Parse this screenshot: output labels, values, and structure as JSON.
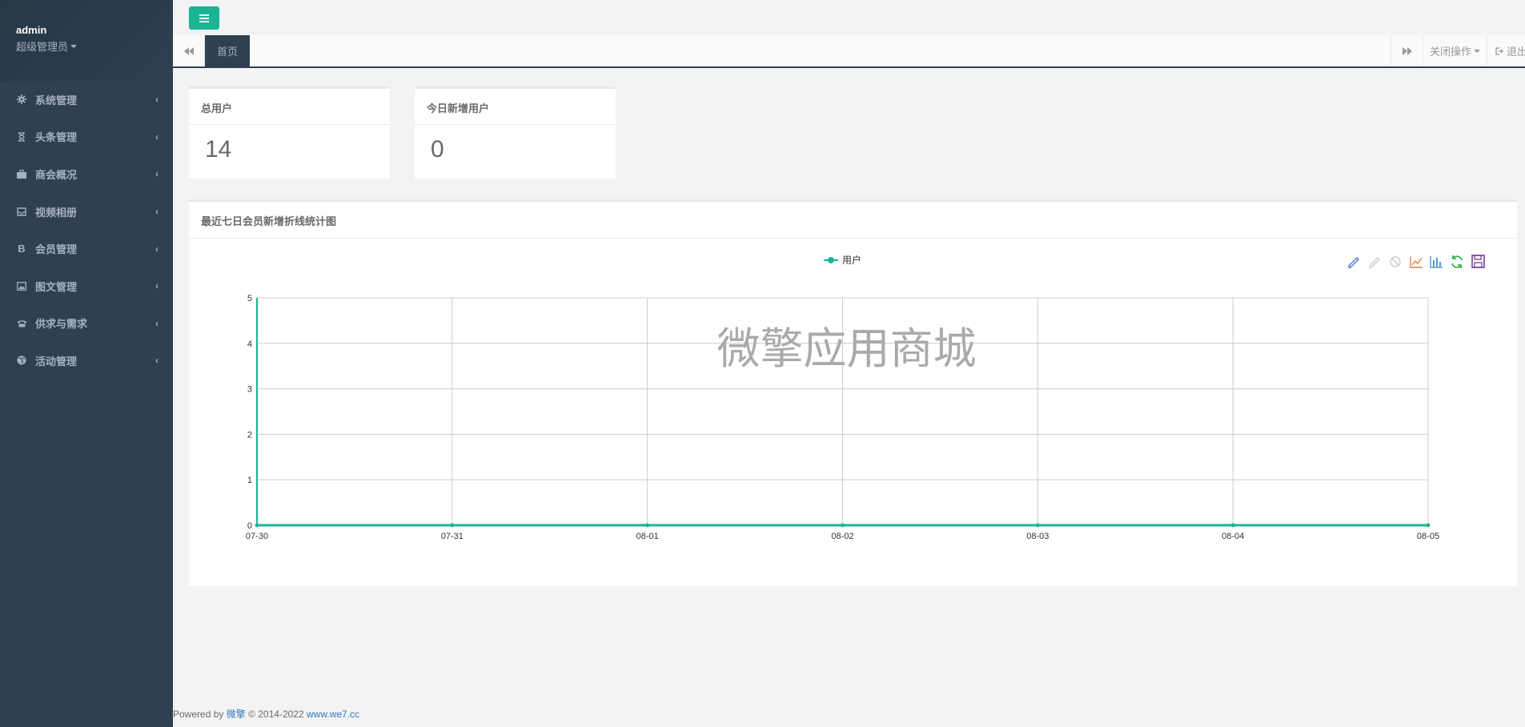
{
  "sidebar": {
    "username": "admin",
    "role": "超级管理员",
    "items": [
      {
        "label": "系统管理",
        "icon": "gear-icon"
      },
      {
        "label": "头条管理",
        "icon": "hourglass-icon"
      },
      {
        "label": "商会概况",
        "icon": "briefcase-icon"
      },
      {
        "label": "视频相册",
        "icon": "inbox-icon"
      },
      {
        "label": "会员管理",
        "icon": "bold-icon"
      },
      {
        "label": "图文管理",
        "icon": "picture-icon"
      },
      {
        "label": "供求与需求",
        "icon": "phone-icon"
      },
      {
        "label": "活动管理",
        "icon": "globe-icon"
      }
    ]
  },
  "tabs": {
    "active": "首页",
    "close_ops": "关闭操作",
    "exit": "退出"
  },
  "stats": {
    "total_users": {
      "title": "总用户",
      "value": "14"
    },
    "today_new": {
      "title": "今日新增用户",
      "value": "0"
    }
  },
  "chart_panel": {
    "title": "最近七日会员新增折线统计图",
    "watermark": "微擎应用商城"
  },
  "chart_data": {
    "type": "line",
    "title": "",
    "categories": [
      "07-30",
      "07-31",
      "08-01",
      "08-02",
      "08-03",
      "08-04",
      "08-05"
    ],
    "series": [
      {
        "name": "用户",
        "values": [
          0,
          0,
          0,
          0,
          0,
          0,
          0
        ],
        "color": "#1ab394"
      }
    ],
    "ylim": [
      0,
      5
    ],
    "yticks": [
      0,
      1,
      2,
      3,
      4,
      5
    ],
    "grid": true,
    "legend": "top-center",
    "toolbox": [
      "edit-icon",
      "erase-icon",
      "block-icon",
      "line-chart-icon",
      "bar-chart-icon",
      "refresh-icon",
      "save-icon"
    ]
  },
  "footer": {
    "powered_by": "Powered by",
    "brand": "微擎",
    "copyright": "© 2014-2022",
    "site": "www.we7.cc"
  },
  "colors": {
    "sidebar_bg": "#2f4050",
    "accent": "#1ab394"
  }
}
